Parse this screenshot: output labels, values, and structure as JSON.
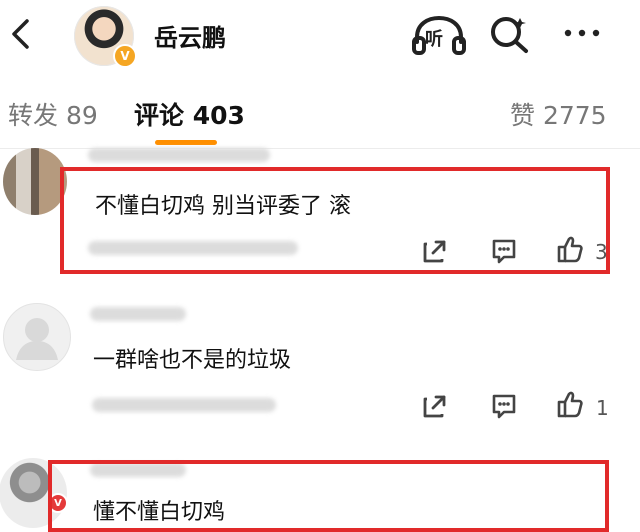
{
  "header": {
    "profile_name": "岳云鹏",
    "listen_label": "听"
  },
  "tabs": {
    "forward_label": "转发 89",
    "comments_label": "评论 403",
    "likes_label": "赞 2775"
  },
  "comments": [
    {
      "text": "不懂白切鸡 别当评委了 滚",
      "like_count": "3"
    },
    {
      "text": "一群啥也不是的垃圾",
      "like_count": "1"
    },
    {
      "text": "懂不懂白切鸡"
    }
  ],
  "colors": {
    "accent": "#ff8f00",
    "highlight": "#e12a2a",
    "verified": "#f5a623"
  },
  "icons": {
    "back": "chevron-left-icon",
    "listen": "headphones-icon",
    "search": "search-icon",
    "more": "more-icon",
    "share": "share-icon",
    "comment": "comment-icon",
    "like": "thumb-up-icon"
  }
}
